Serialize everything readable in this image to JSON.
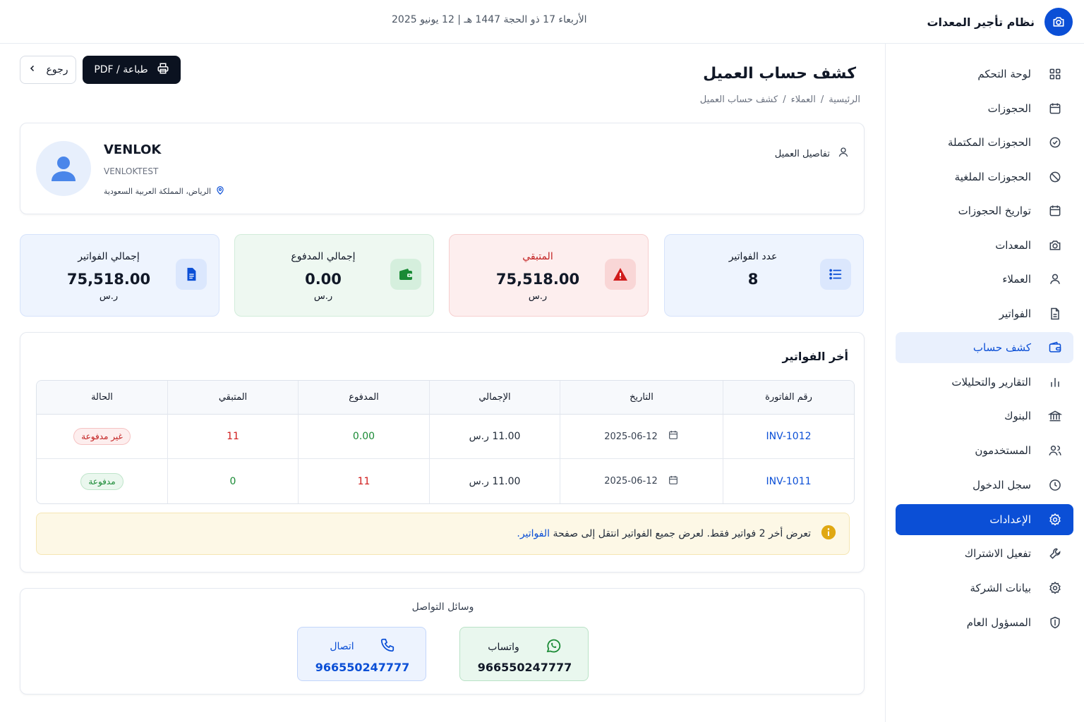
{
  "app": {
    "title": "نظام تأجير المعدات",
    "icon": "camera-icon"
  },
  "topbar": {
    "date": "الأربعاء 17 ذو الحجة 1447 هـ | 12 يونيو 2025"
  },
  "sidebar": {
    "items": [
      {
        "label": "لوحة التحكم",
        "icon": "grid-icon"
      },
      {
        "label": "الحجوزات",
        "icon": "calendar-icon"
      },
      {
        "label": "الحجوزات المكتملة",
        "icon": "check-circle-icon"
      },
      {
        "label": "الحجوزات الملغية",
        "icon": "ban-icon"
      },
      {
        "label": "تواريخ الحجوزات",
        "icon": "calendar-icon"
      },
      {
        "label": "المعدات",
        "icon": "camera-icon"
      },
      {
        "label": "العملاء",
        "icon": "user-icon"
      },
      {
        "label": "الفواتير",
        "icon": "file-icon"
      },
      {
        "label": "كشف حساب",
        "icon": "wallet-icon",
        "state": "highlighted"
      },
      {
        "label": "التقارير والتحليلات",
        "icon": "bar-chart-icon"
      },
      {
        "label": "البنوك",
        "icon": "bank-icon"
      },
      {
        "label": "المستخدمون",
        "icon": "users-icon"
      },
      {
        "label": "سجل الدخول",
        "icon": "clock-icon"
      },
      {
        "label": "الإعدادات",
        "icon": "gear-icon",
        "state": "active"
      },
      {
        "label": "تفعيل الاشتراك",
        "icon": "wrench-icon"
      },
      {
        "label": "بيانات الشركة",
        "icon": "gear-icon"
      },
      {
        "label": "المسؤول العام",
        "icon": "shield-icon"
      }
    ]
  },
  "header": {
    "title": "كشف حساب العميل",
    "breadcrumb": [
      "الرئيسية",
      "/",
      "العملاء",
      "/",
      "كشف حساب العميل"
    ],
    "print_label": "طباعة / PDF",
    "back_label": "رجوع"
  },
  "customer": {
    "section_label": "تفاصيل العميل",
    "name": "VENLOK",
    "code": "VENLOKTEST",
    "location": "الرياض، المملكة العربية السعودية"
  },
  "stats": [
    {
      "label": "عدد الفواتير",
      "value": "8",
      "unit": "",
      "icon": "list-icon"
    },
    {
      "label": "المتبقي",
      "value": "75,518.00",
      "unit": "ر.س",
      "icon": "warning-icon"
    },
    {
      "label": "إجمالي المدفوع",
      "value": "0.00",
      "unit": "ر.س",
      "icon": "wallet-icon"
    },
    {
      "label": "إجمالي الفواتير",
      "value": "75,518.00",
      "unit": "ر.س",
      "icon": "document-icon"
    }
  ],
  "invoices": {
    "title": "أخر الفواتير",
    "columns": [
      "رقم الفاتورة",
      "التاريخ",
      "الإجمالي",
      "المدفوع",
      "المتبقي",
      "الحالة"
    ],
    "rows": [
      {
        "number": "INV-1012",
        "date": "2025-06-12",
        "total": "11.00 ر.س",
        "paid": "0.00",
        "remaining": "11",
        "status": "غير مدفوعة"
      },
      {
        "number": "INV-1011",
        "date": "2025-06-12",
        "total": "11.00 ر.س",
        "paid": "11",
        "remaining": "0",
        "status": "مدفوعة"
      }
    ],
    "notice_text": "تعرض أخر 2 فواتير فقط. لعرض جميع الفواتير انتقل إلى صفحة",
    "notice_link": "الفواتير."
  },
  "contact": {
    "title": "وسائل التواصل",
    "whatsapp": {
      "label": "واتساب",
      "number": "966550247777",
      "icon": "whatsapp-icon"
    },
    "call": {
      "label": "اتصال",
      "number": "966550247777",
      "icon": "phone-icon"
    }
  },
  "colors": {
    "primary": "#0b4fd6",
    "dark_button": "#0b1220",
    "danger": "#d01b1b",
    "success": "#1a8a35",
    "notice_bg": "#fdf8e6"
  }
}
